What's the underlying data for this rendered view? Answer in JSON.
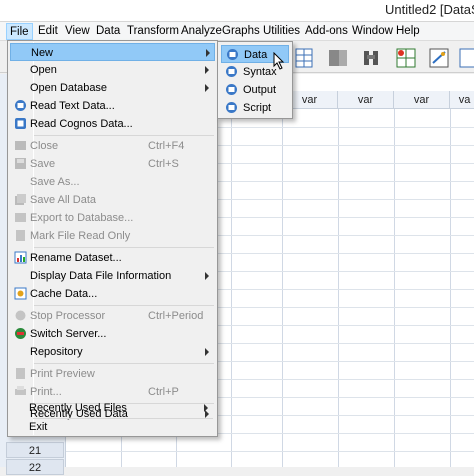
{
  "window": {
    "title": "Untitled2 [DataSe"
  },
  "menubar": {
    "items": [
      {
        "label": "File"
      },
      {
        "label": "Edit"
      },
      {
        "label": "View"
      },
      {
        "label": "Data"
      },
      {
        "label": "Transform"
      },
      {
        "label": "Analyze"
      },
      {
        "label": "Graphs"
      },
      {
        "label": "Utilities"
      },
      {
        "label": "Add-ons"
      },
      {
        "label": "Window"
      },
      {
        "label": "Help"
      }
    ]
  },
  "file_menu": {
    "items": [
      {
        "label": "New",
        "submenu": true,
        "highlighted": true
      },
      {
        "label": "Open",
        "submenu": true
      },
      {
        "label": "Open Database",
        "submenu": true
      },
      {
        "label": "Read Text Data..."
      },
      {
        "label": "Read Cognos Data..."
      },
      {
        "label": "Close",
        "shortcut": "Ctrl+F4",
        "disabled": true
      },
      {
        "label": "Save",
        "shortcut": "Ctrl+S",
        "disabled": true
      },
      {
        "label": "Save As...",
        "disabled": true
      },
      {
        "label": "Save All Data",
        "disabled": true
      },
      {
        "label": "Export to Database...",
        "disabled": true
      },
      {
        "label": "Mark File Read Only",
        "disabled": true
      },
      {
        "label": "Rename Dataset..."
      },
      {
        "label": "Display Data File Information",
        "submenu": true
      },
      {
        "label": "Cache Data..."
      },
      {
        "label": "Stop Processor",
        "shortcut": "Ctrl+Period",
        "disabled": true
      },
      {
        "label": "Switch Server..."
      },
      {
        "label": "Repository",
        "submenu": true
      },
      {
        "label": "Print Preview",
        "disabled": true
      },
      {
        "label": "Print...",
        "shortcut": "Ctrl+P",
        "disabled": true
      },
      {
        "label": "Recently Used Data",
        "submenu": true
      },
      {
        "label": "Recently Used Files",
        "submenu": true
      },
      {
        "label": "Exit"
      }
    ]
  },
  "new_submenu": {
    "items": [
      {
        "label": "Data",
        "highlighted": true
      },
      {
        "label": "Syntax"
      },
      {
        "label": "Output"
      },
      {
        "label": "Script"
      }
    ]
  },
  "grid": {
    "var_headers": [
      "var",
      "var",
      "var",
      "va"
    ],
    "visible_row_numbers": [
      "21",
      "22"
    ]
  },
  "colors": {
    "highlight": "#91c9f7",
    "menu_bg": "#f0f0f0",
    "disabled_text": "#8c8c8c"
  }
}
